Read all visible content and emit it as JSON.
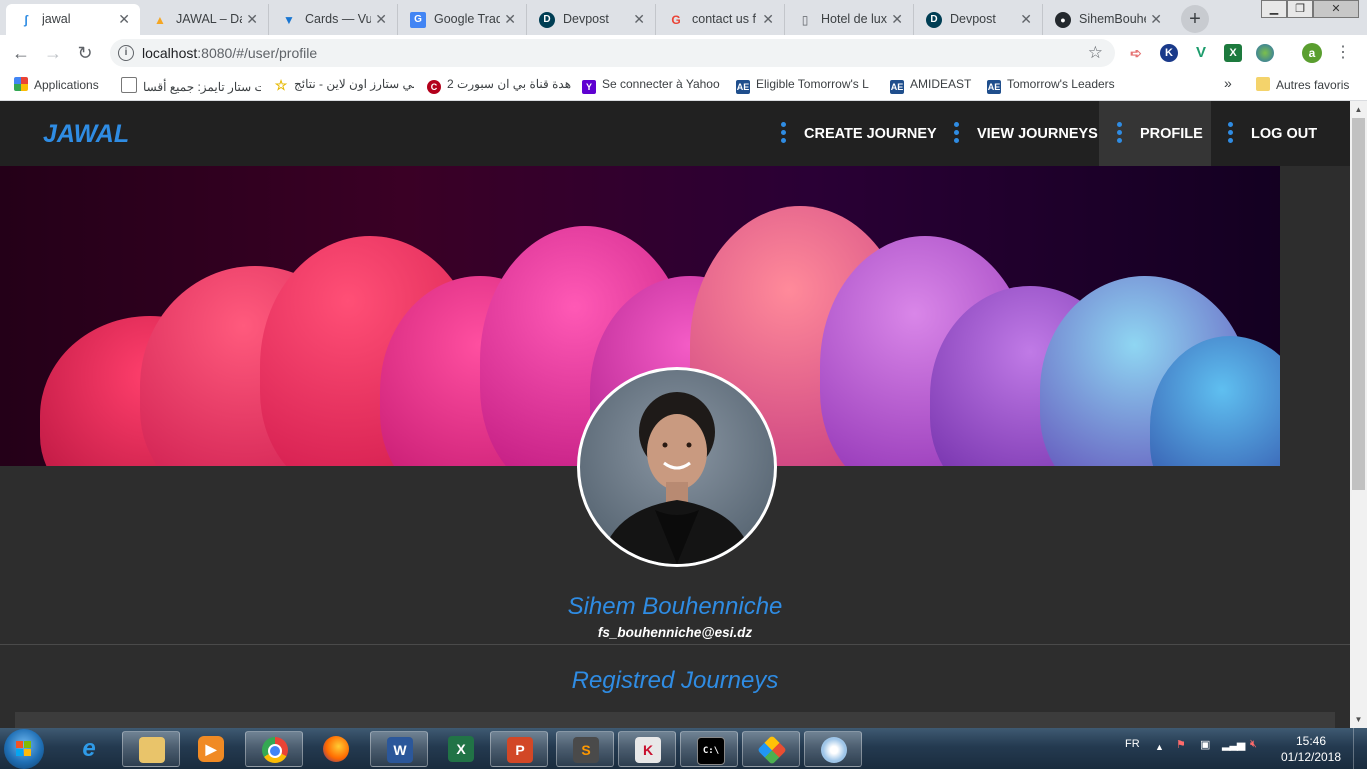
{
  "browser": {
    "tabs": [
      {
        "title": "jawal",
        "active": true,
        "icon": "jawal-favicon"
      },
      {
        "title": "JAWAL – Da",
        "icon": "firebase-favicon"
      },
      {
        "title": "Cards — Vu",
        "icon": "vuetify-favicon"
      },
      {
        "title": "Google Trad",
        "icon": "google-translate-favicon"
      },
      {
        "title": "Devpost",
        "icon": "devpost-favicon"
      },
      {
        "title": "contact us f",
        "icon": "google-favicon"
      },
      {
        "title": "Hotel de lux",
        "icon": "page-favicon"
      },
      {
        "title": "Devpost",
        "icon": "devpost-favicon"
      },
      {
        "title": "SihemBouhe",
        "icon": "github-favicon"
      }
    ],
    "tab_close": "✕",
    "new_tab": "+",
    "url_host": "localhost",
    "url_rest": ":8080/#/user/profile",
    "profile_initial": "a"
  },
  "bookmarks": {
    "apps_label": "Applications",
    "items": [
      "منتديات ستار تايمز: جميع أقسا",
      "انمي ستارز اون لاين - نتائج",
      "مشاهدة قناة بي ان سبورت 2",
      "Se connecter à Yahoo",
      "Eligible Tomorrow's L",
      "AMIDEAST",
      "Tomorrow's Leaders"
    ],
    "overflow": "»",
    "other_label": "Autres favoris"
  },
  "app": {
    "brand": "JAWAL",
    "nav": [
      {
        "label": "CREATE JOURNEY",
        "active": false
      },
      {
        "label": "VIEW JOURNEYS",
        "active": false
      },
      {
        "label": "PROFILE",
        "active": true
      },
      {
        "label": "LOG OUT",
        "active": false
      }
    ],
    "profile": {
      "name": "Sihem Bouhenniche",
      "email": "fs_bouhenniche@esi.dz"
    },
    "journeys_title": "Registred Journeys"
  },
  "taskbar": {
    "language": "FR",
    "time": "15:46",
    "date": "01/12/2018"
  },
  "colors": {
    "accent": "#2f8ce3",
    "appbar": "#212121",
    "page_bg": "#2d2d2d"
  }
}
